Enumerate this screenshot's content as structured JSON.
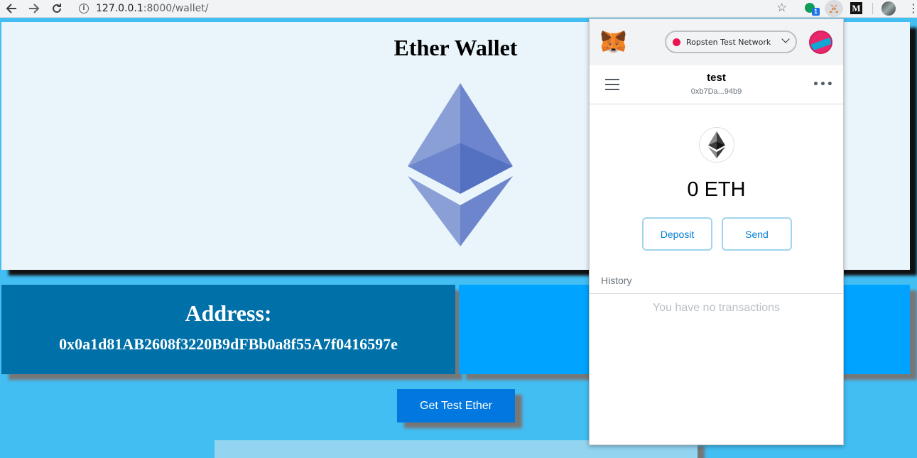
{
  "browser": {
    "url_host": "127.0.0.1",
    "url_rest": ":8000/wallet/",
    "ext_badge": "1",
    "ext_m_label": "M"
  },
  "page": {
    "title": "Ether Wallet",
    "address_label": "Address:",
    "address_value": "0x0a1d81AB2608f3220B9dFBb0a8f55A7f0416597e",
    "get_test_ether_label": "Get Test Ether"
  },
  "metamask": {
    "network": "Ropsten Test Network",
    "network_color": "#e91550",
    "account_name": "test",
    "account_address": "0xb7Da...94b9",
    "balance": "0 ETH",
    "deposit_label": "Deposit",
    "send_label": "Send",
    "history_label": "History",
    "no_transactions": "You have no transactions"
  }
}
